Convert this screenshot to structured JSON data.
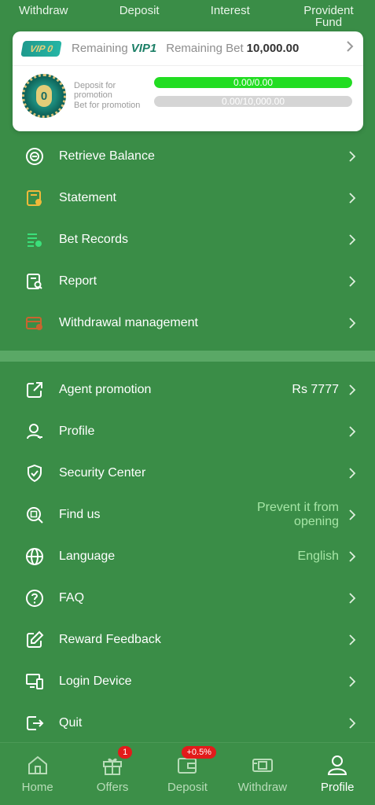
{
  "top_tabs": [
    "Withdraw",
    "Deposit",
    "Interest",
    "Provident Fund"
  ],
  "vip": {
    "badge": "VIP 0",
    "remaining_label": "Remaining",
    "next_level": "VIP1",
    "remaining_bet_label": "Remaining Bet",
    "remaining_bet_value": "10,000.00",
    "medal_level": "0",
    "deposit_label": "Deposit for promotion",
    "bet_label": "Bet for promotion",
    "deposit_progress": "0.00/0.00",
    "deposit_progress_fraction": 1.0,
    "bet_progress": "0.00/10,000.00",
    "bet_progress_fraction": 0.0
  },
  "menu_group1": [
    {
      "label": "Retrieve Balance",
      "icon": "retrieve-balance-icon"
    },
    {
      "label": "Statement",
      "icon": "statement-icon"
    },
    {
      "label": "Bet Records",
      "icon": "bet-records-icon"
    },
    {
      "label": "Report",
      "icon": "report-icon"
    },
    {
      "label": "Withdrawal management",
      "icon": "withdrawal-management-icon"
    }
  ],
  "menu_group2": [
    {
      "label": "Agent promotion",
      "value": "Rs 7777",
      "icon": "share-icon"
    },
    {
      "label": "Profile",
      "value": "",
      "icon": "user-icon"
    },
    {
      "label": "Security Center",
      "value": "",
      "icon": "shield-icon"
    },
    {
      "label": "Find us",
      "value_line1": "Prevent it from",
      "value_line2": "opening",
      "icon": "find-icon"
    },
    {
      "label": "Language",
      "value": "English",
      "icon": "globe-icon"
    },
    {
      "label": "FAQ",
      "value": "",
      "icon": "question-icon"
    },
    {
      "label": "Reward Feedback",
      "value": "",
      "icon": "edit-icon"
    },
    {
      "label": "Login Device",
      "value": "",
      "icon": "devices-icon"
    },
    {
      "label": "Quit",
      "value": "",
      "icon": "logout-icon"
    }
  ],
  "bottom_nav": [
    {
      "label": "Home",
      "icon": "home-icon"
    },
    {
      "label": "Offers",
      "icon": "gift-icon",
      "badge": "1"
    },
    {
      "label": "Deposit",
      "icon": "wallet-icon",
      "badge": "+0.5%"
    },
    {
      "label": "Withdraw",
      "icon": "withdraw-icon"
    },
    {
      "label": "Profile",
      "icon": "profile-icon",
      "active": true
    }
  ],
  "colors": {
    "background": "#3a8d47",
    "progress_fill": "#22dd22",
    "badge_red": "#e21b1b"
  }
}
